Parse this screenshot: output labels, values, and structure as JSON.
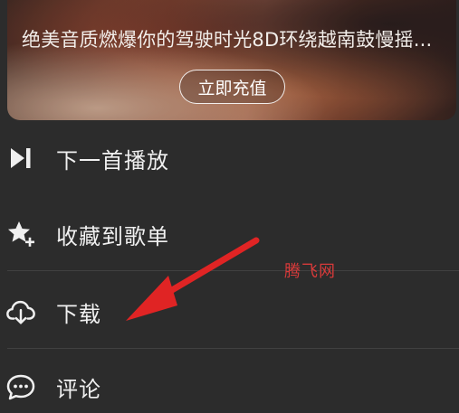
{
  "banner": {
    "text": "绝美音质燃爆你的驾驶时光8D环绕越南鼓慢摇...",
    "button_label": "立即充值"
  },
  "menu": {
    "items": [
      {
        "label": "下一首播放",
        "icon": "play-next-icon"
      },
      {
        "label": "收藏到歌单",
        "icon": "star-add-icon"
      },
      {
        "label": "下载",
        "icon": "cloud-download-icon"
      },
      {
        "label": "评论",
        "icon": "comment-icon"
      }
    ]
  },
  "watermark": "腾飞网",
  "colors": {
    "background": "#2c2c2c",
    "text": "#f0f0f0",
    "arrow": "#e02424"
  }
}
